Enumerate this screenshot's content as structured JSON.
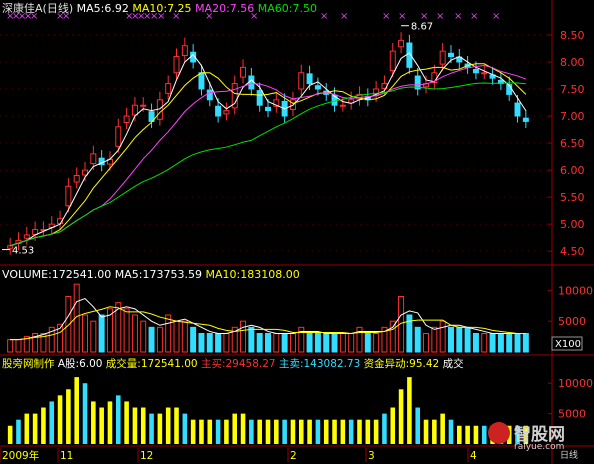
{
  "header": {
    "stock": "深康佳A",
    "period": "(日线)",
    "ma5": "MA5:6.92",
    "ma10": "MA10:7.25",
    "ma20": "MA20:7.56",
    "ma60": "MA60:7.50"
  },
  "volume_header": {
    "volume": "VOLUME:172541.00",
    "ma5": "MA5:173753.59",
    "ma10": "MA10:183108.00"
  },
  "indicator_header": {
    "maker": "股旁网制作",
    "a_shares": "A股:6.00",
    "turnover": "成交量:172541.00",
    "main_buy": "主买:29458.27",
    "main_sell": "主卖:143082.73",
    "fund_change": "资金异动:95.42",
    "deal": "成交"
  },
  "price_axis": [
    "8.50",
    "8.00",
    "7.50",
    "7.00",
    "6.50",
    "6.00",
    "5.50",
    "5.00",
    "4.50"
  ],
  "volume_axis": [
    "10000",
    "5000"
  ],
  "volume_unit": "X100",
  "indicator_axis": [
    "10000",
    "5000"
  ],
  "annotations": {
    "high": "8.67",
    "low": "4.53"
  },
  "date_axis": [
    "2009年",
    "11",
    "12",
    "2",
    "3",
    "4"
  ],
  "watermark": {
    "brand": "智股网",
    "url": "raiyue.com",
    "suffix": "日线"
  },
  "colors": {
    "up": "#ff3030",
    "down": "#33ddff",
    "ma5": "#ffffff",
    "ma10": "#ffff00",
    "ma20": "#ff40ff",
    "ma60": "#00e000",
    "grid": "#990000",
    "accent": "#cc44cc"
  },
  "chart_data": {
    "type": "candlestick",
    "title": "深康佳A (日线)",
    "price_range": [
      4.3,
      8.85
    ],
    "high": 8.67,
    "low": 4.53,
    "ma_latest": {
      "MA5": 6.92,
      "MA10": 7.25,
      "MA20": 7.56,
      "MA60": 7.5
    },
    "close_series": [
      4.6,
      4.7,
      4.8,
      4.9,
      4.9,
      5.0,
      5.1,
      5.7,
      5.9,
      6.0,
      6.3,
      6.1,
      6.2,
      6.8,
      7.0,
      7.2,
      7.2,
      6.9,
      7.3,
      7.6,
      8.1,
      8.3,
      8.0,
      7.5,
      7.3,
      7.0,
      7.1,
      7.6,
      7.9,
      7.5,
      7.2,
      7.1,
      7.3,
      7.0,
      7.3,
      7.8,
      7.6,
      7.5,
      7.4,
      7.2,
      7.2,
      7.3,
      7.4,
      7.3,
      7.5,
      7.6,
      8.2,
      8.4,
      7.9,
      7.5,
      7.6,
      7.8,
      8.2,
      8.1,
      8.0,
      7.9,
      7.8,
      7.8,
      7.7,
      7.6,
      7.4,
      7.0,
      6.9
    ],
    "volume_series": [
      2,
      2,
      2.5,
      3,
      3,
      4,
      4.5,
      9,
      11,
      6,
      5,
      6,
      7,
      8,
      7,
      6,
      5,
      4,
      4,
      6,
      5,
      5,
      4,
      3,
      3,
      3,
      3,
      4,
      5,
      4,
      3,
      3,
      3,
      3,
      3,
      4,
      3,
      3,
      3,
      3,
      3,
      3,
      4,
      3,
      3,
      4,
      5,
      9,
      6,
      4,
      3,
      4,
      5,
      4,
      4,
      4,
      3,
      3,
      3,
      3,
      3,
      3,
      3
    ],
    "indicator_series": [
      3,
      4,
      5,
      5,
      6,
      7,
      8,
      9,
      11,
      10,
      7,
      6,
      7,
      8,
      7,
      6,
      6,
      5,
      5,
      6,
      6,
      5,
      4,
      4,
      4,
      4,
      4,
      5,
      5,
      4,
      4,
      4,
      4,
      4,
      4,
      4,
      4,
      4,
      4,
      4,
      4,
      4,
      4,
      4,
      4,
      5,
      6,
      9,
      11,
      6,
      4,
      4,
      5,
      4,
      3,
      3,
      3,
      3,
      3,
      3,
      3,
      3,
      3
    ],
    "units": {
      "volume": "X100"
    }
  }
}
